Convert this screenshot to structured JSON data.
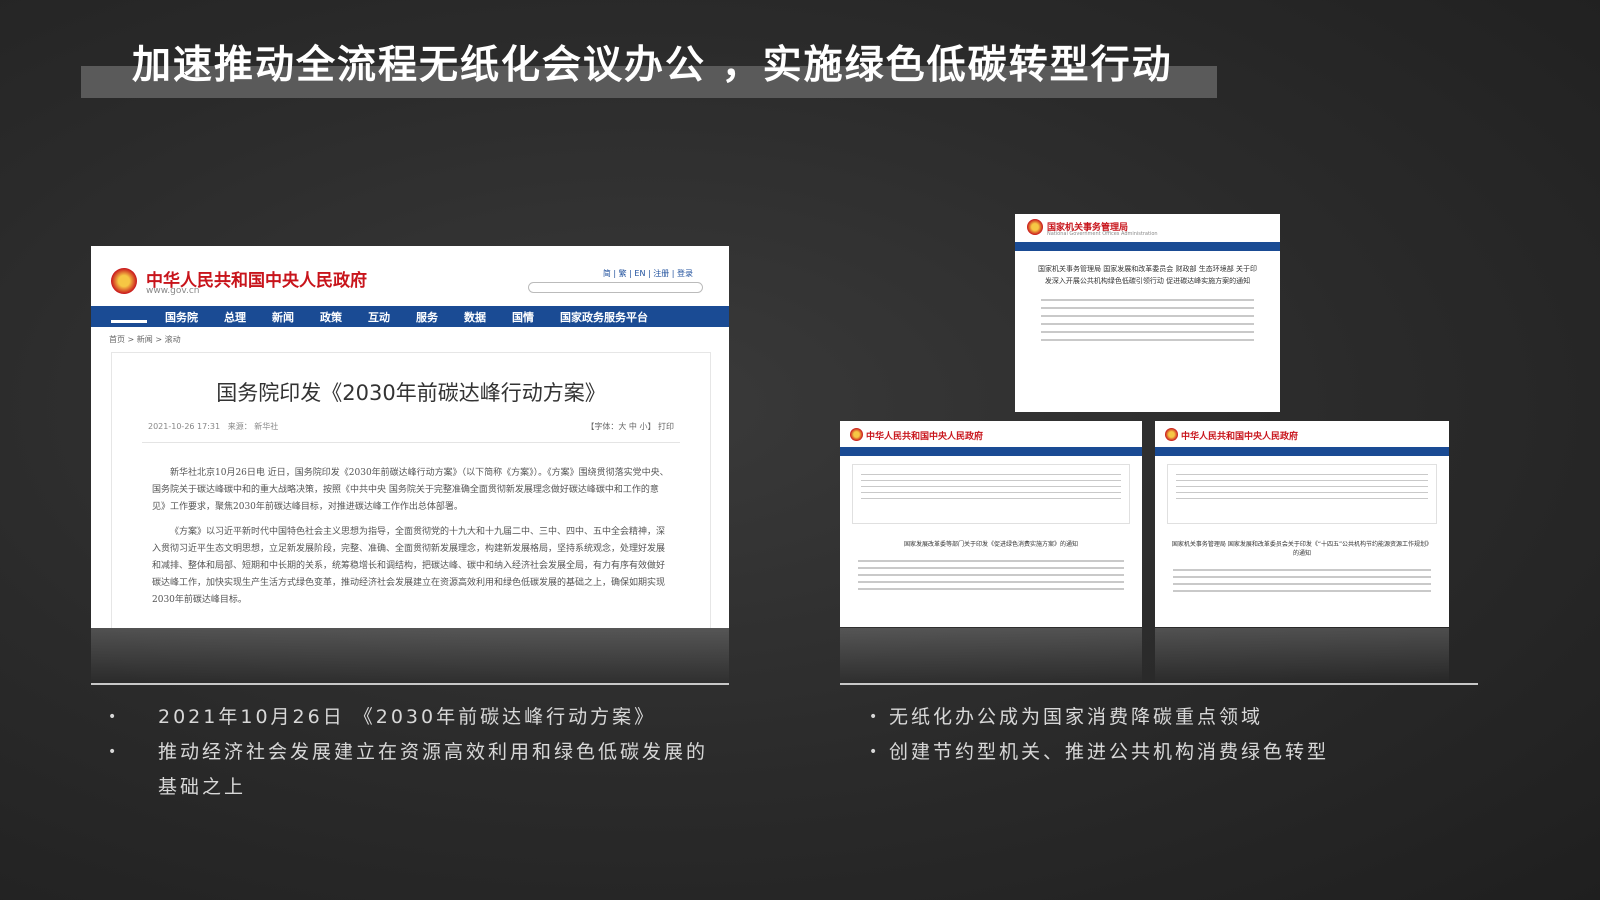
{
  "slide": {
    "title": "加速推动全流程无纸化会议办公 ，实施绿色低碳转型行动"
  },
  "main_shot": {
    "site_name": "中华人民共和国中央人民政府",
    "site_url": "www.gov.cn",
    "header_links": "简 | 繁 | EN | 注册 | 登录",
    "nav": [
      "国务院",
      "总理",
      "新闻",
      "政策",
      "互动",
      "服务",
      "数据",
      "国情",
      "国家政务服务平台"
    ],
    "breadcrumb": "首页 > 新闻 > 滚动",
    "doc_title": "国务院印发《2030年前碳达峰行动方案》",
    "doc_date": "2021-10-26 17:31",
    "doc_source": "来源： 新华社",
    "doc_tools": "【字体：大 中 小】 打印",
    "paragraphs": [
      "新华社北京10月26日电 近日，国务院印发《2030年前碳达峰行动方案》（以下简称《方案》）。《方案》围绕贯彻落实党中央、国务院关于碳达峰碳中和的重大战略决策，按照《中共中央 国务院关于完整准确全面贯彻新发展理念做好碳达峰碳中和工作的意见》工作要求，聚焦2030年前碳达峰目标，对推进碳达峰工作作出总体部署。",
      "《方案》以习近平新时代中国特色社会主义思想为指导，全面贯彻党的十九大和十九届二中、三中、四中、五中全会精神，深入贯彻习近平生态文明思想，立足新发展阶段，完整、准确、全面贯彻新发展理念，构建新发展格局，坚持系统观念，处理好发展和减排、整体和局部、短期和中长期的关系，统筹稳增长和调结构，把碳达峰、碳中和纳入经济社会发展全局，有力有序有效做好碳达峰工作，加快实现生产生活方式绿色变革，推动经济社会发展建立在资源高效利用和绿色低碳发展的基础之上，确保如期实现2030年前碳达峰目标。"
    ]
  },
  "gao_shot": {
    "site_name": "国家机关事务管理局",
    "site_sub": "National Government Offices Administration",
    "doc_title": "国家机关事务管理局 国家发展和改革委员会 财政部 生态环境部 关于印发深入开展公共机构绿色低碳引领行动 促进碳达峰实施方案的通知"
  },
  "small_shot_1": {
    "site_name": "中华人民共和国中央人民政府",
    "doc_title": "国家发展改革委等部门关于印发《促进绿色消费实施方案》的通知"
  },
  "small_shot_2": {
    "site_name": "中华人民共和国中央人民政府",
    "doc_title": "国家机关事务管理局 国家发展和改革委员会关于印发《“十四五”公共机构节约能源资源工作规划》的通知"
  },
  "bullets_left": [
    "2021年10月26日 《2030年前碳达峰行动方案》",
    "推动经济社会发展建立在资源高效利用和绿色低碳发展的基础之上"
  ],
  "bullets_right": [
    "无纸化办公成为国家消费降碳重点领域",
    "创建节约型机关、推进公共机构消费绿色转型"
  ]
}
